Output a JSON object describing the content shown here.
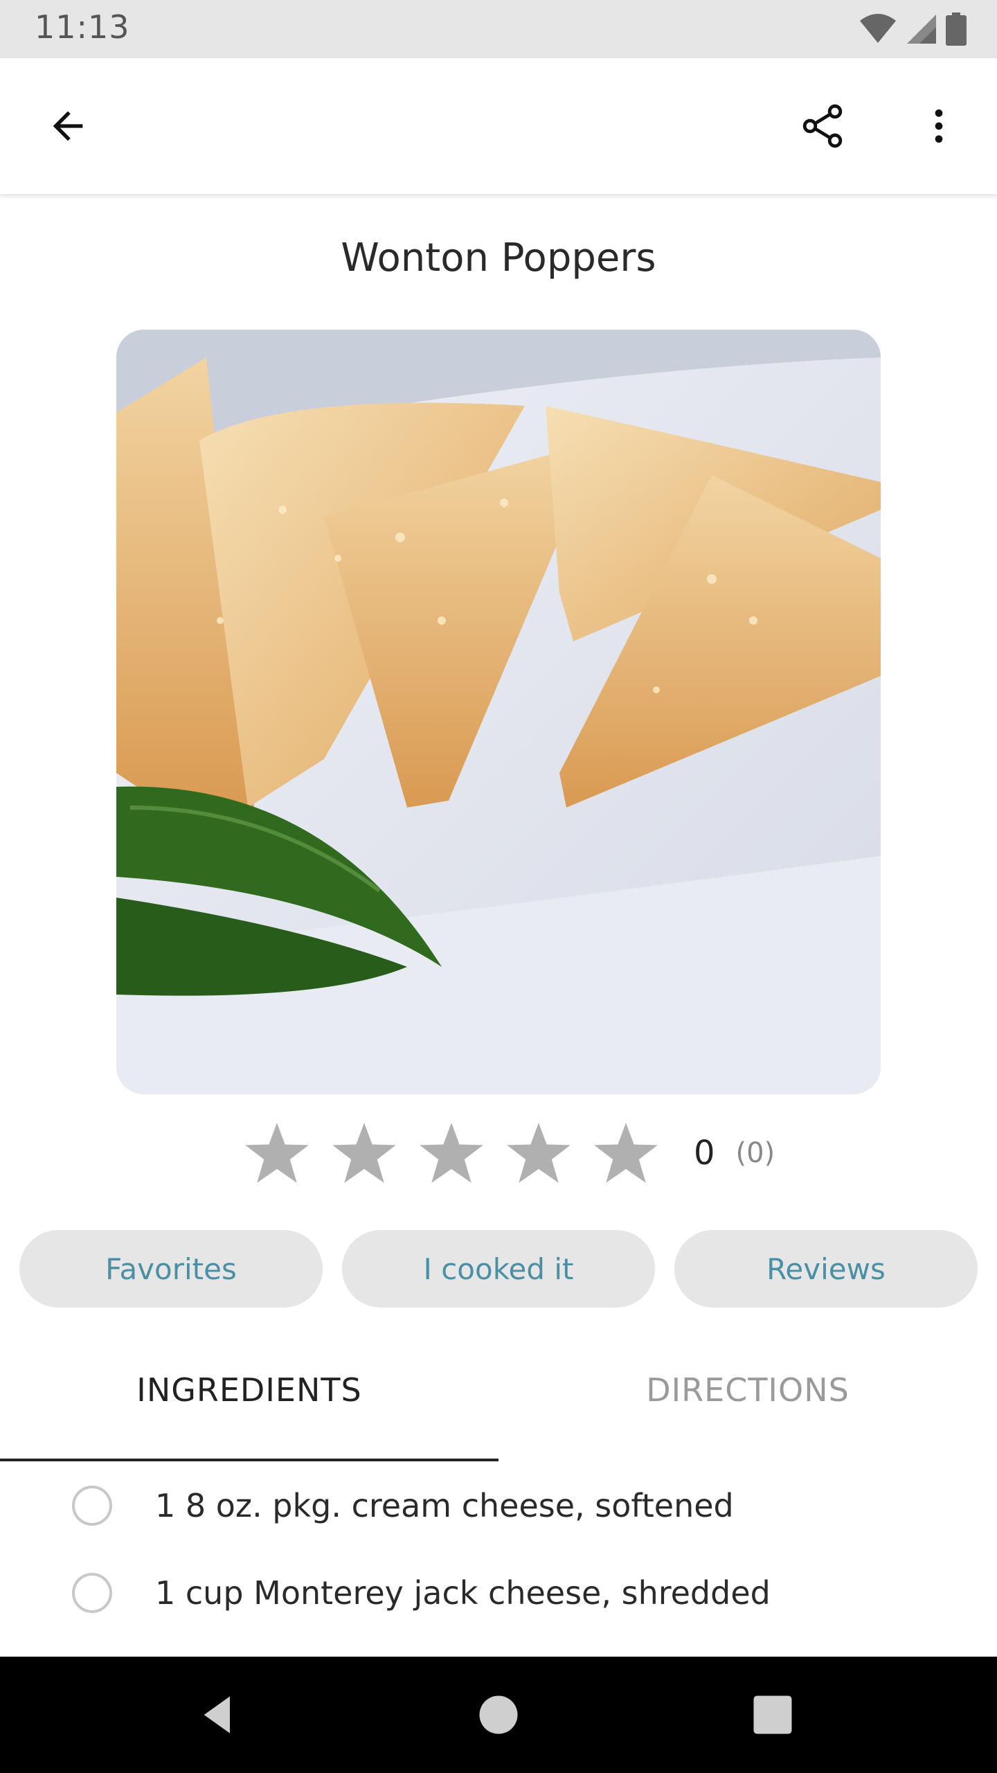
{
  "status_bar": {
    "time": "11:13",
    "icons": [
      "wifi-icon",
      "signal-icon",
      "battery-icon"
    ]
  },
  "app_bar": {
    "icons": [
      "back-arrow-icon",
      "share-icon",
      "more-vert-icon"
    ]
  },
  "recipe": {
    "title": "Wonton Poppers",
    "rating": {
      "value": "0",
      "count": "(0)",
      "stars_filled": 0,
      "stars_total": 5
    }
  },
  "actions": {
    "favorites_label": "Favorites",
    "cooked_label": "I cooked it",
    "reviews_label": "Reviews"
  },
  "tabs": {
    "ingredients_label": "INGREDIENTS",
    "directions_label": "DIRECTIONS",
    "selected": "INGREDIENTS"
  },
  "ingredients": [
    "1 8 oz. pkg. cream cheese, softened",
    "1 cup Monterey jack cheese, shredded"
  ],
  "colors": {
    "accent": "#4a8fa3",
    "pill_bg": "#e6e6e6",
    "star": "#b0b0b0",
    "status_bar": "#e6e6e6"
  },
  "nav_bar": {
    "icons": [
      "nav-back-icon",
      "nav-home-icon",
      "nav-recent-icon"
    ]
  }
}
